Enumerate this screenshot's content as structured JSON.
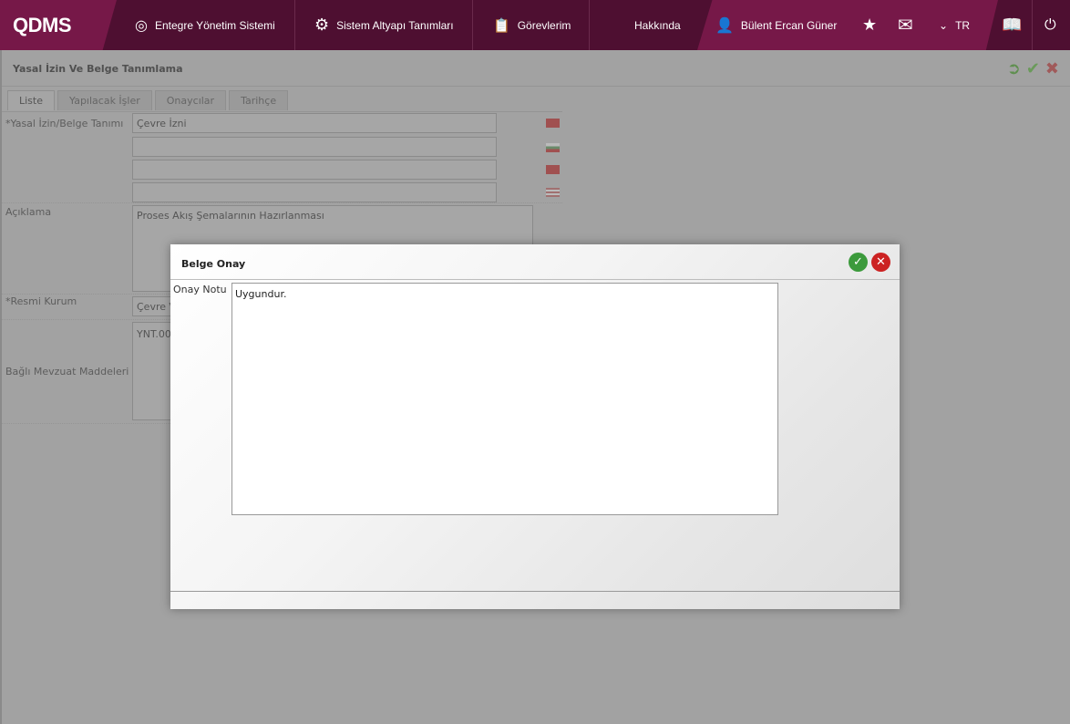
{
  "nav": {
    "logo": "QDMS",
    "items": [
      "Entegre Yönetim Sistemi",
      "Sistem Altyapı Tanımları",
      "Görevlerim",
      "Hakkında"
    ],
    "user": "Bülent Ercan Güner",
    "lang": "TR"
  },
  "page": {
    "title": "Yasal İzin Ve Belge Tanımlama",
    "tabs": [
      "Liste",
      "Yapılacak İşler",
      "Onaycılar",
      "Tarihçe"
    ],
    "fields": {
      "name_label": "*Yasal İzin/Belge Tanımı",
      "name_value": "Çevre İzni",
      "desc_label": "Açıklama",
      "desc_value": "Proses Akış Şemalarının Hazırlanması",
      "inst_label": "*Resmi Kurum",
      "inst_value": "Çevre Ve",
      "reg_label": "Bağlı Mevzuat Maddeleri",
      "reg_value": "YNT.005"
    }
  },
  "dialog": {
    "title": "Belge Onay",
    "note_label": "Onay Notu",
    "note_value": "Uygundur."
  }
}
